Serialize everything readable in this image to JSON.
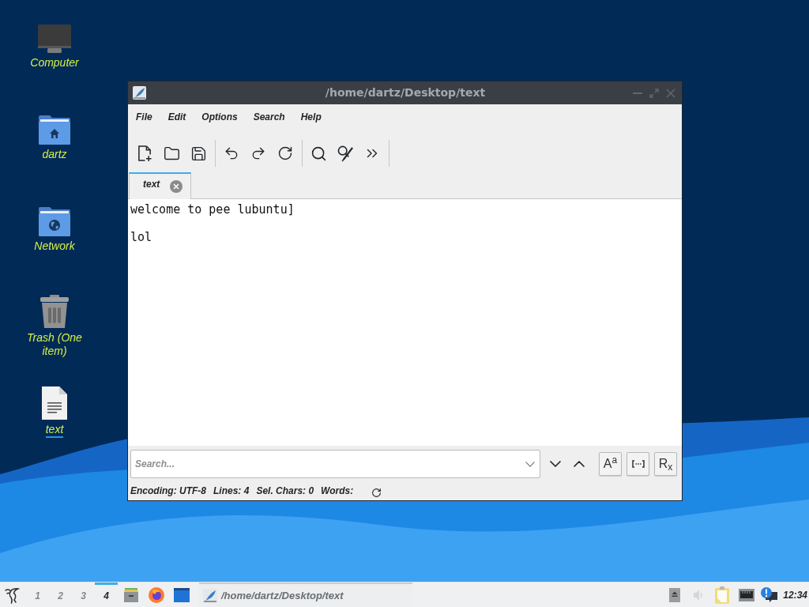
{
  "desktop_icons": [
    {
      "kind": "computer",
      "label": "Computer",
      "focused": false
    },
    {
      "kind": "home-folder",
      "label": "dartz",
      "focused": false
    },
    {
      "kind": "network-folder",
      "label": "Network",
      "focused": false
    },
    {
      "kind": "trash",
      "label": "Trash (One item)",
      "focused": false
    },
    {
      "kind": "text-file",
      "label": "text",
      "focused": true
    }
  ],
  "window": {
    "title": "/home/dartz/Desktop/text",
    "menu": [
      "File",
      "Edit",
      "Options",
      "Search",
      "Help"
    ],
    "tabs": [
      {
        "label": "text",
        "selected": true
      }
    ],
    "editor": {
      "text": "welcome to pee lubuntu]\n\nlol"
    },
    "search": {
      "placeholder": "Search..."
    },
    "search_options": [
      {
        "kind": "match-case",
        "label": "A$^{a}$"
      },
      {
        "kind": "whole-word"
      },
      {
        "kind": "regex",
        "label": "R$_{x}$"
      }
    ],
    "status_bar": [
      {
        "label": "Encoding:",
        "value": "UTF-8"
      },
      {
        "label": "Lines:",
        "value": "4"
      },
      {
        "label": "Sel. Chars:",
        "value": "0"
      },
      {
        "label": "Words:"
      }
    ]
  },
  "taskbar": {
    "desktops": [
      {
        "label": "1",
        "selected": false
      },
      {
        "label": "2",
        "selected": false
      },
      {
        "label": "3",
        "selected": false
      },
      {
        "label": "4",
        "selected": true
      }
    ],
    "tasks": [
      {
        "title": "/home/dartz/Desktop/text"
      }
    ],
    "clock": "12:34"
  }
}
